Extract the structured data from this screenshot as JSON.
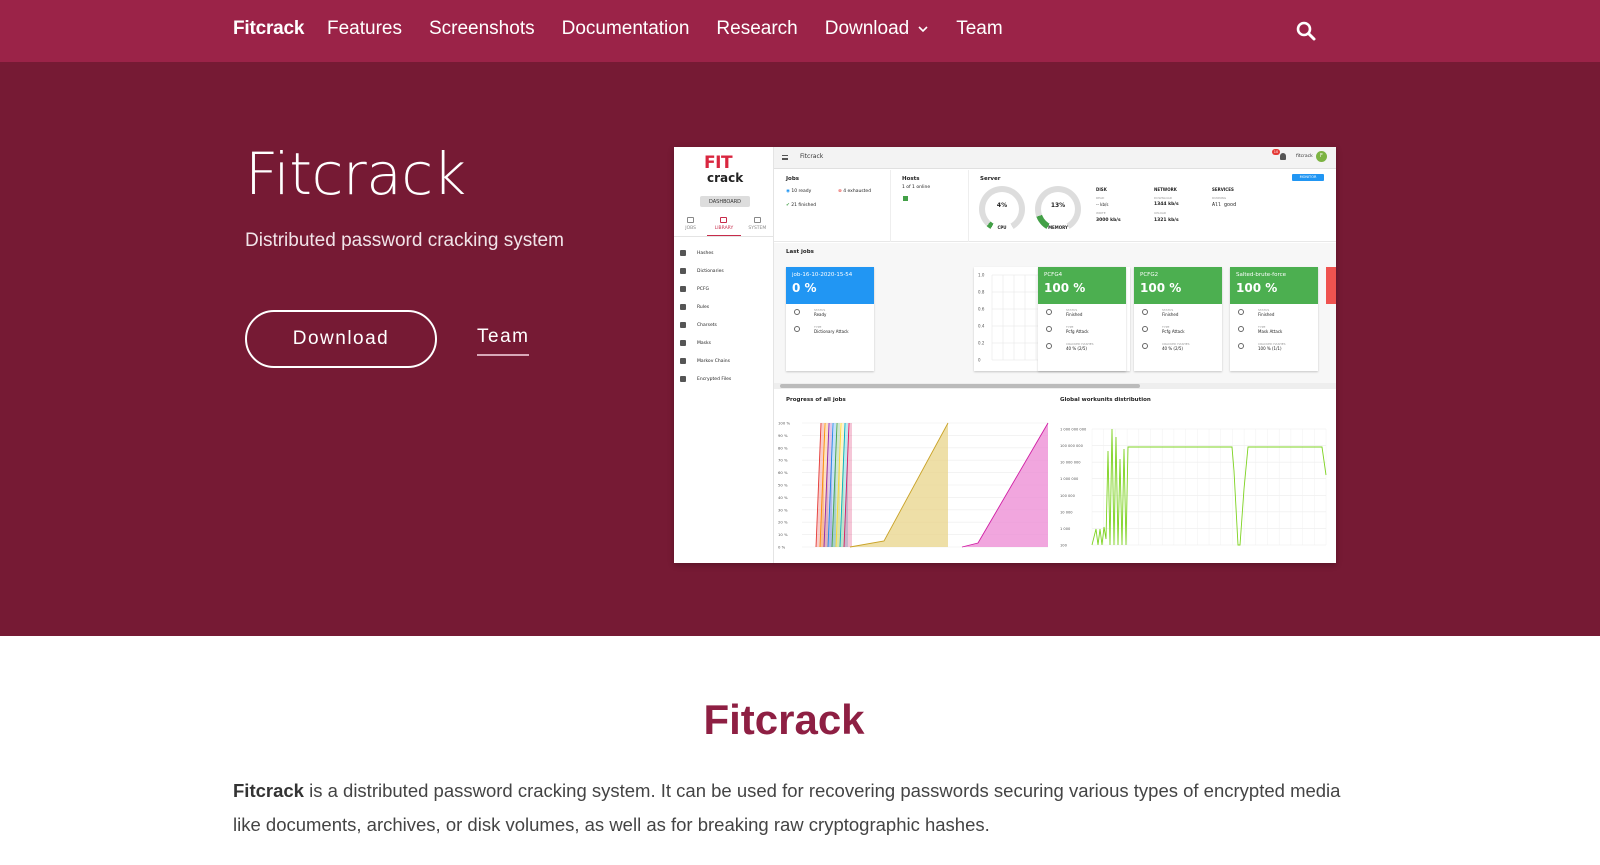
{
  "nav": {
    "brand": "Fitcrack",
    "items": [
      "Features",
      "Screenshots",
      "Documentation",
      "Research",
      "Download",
      "Team"
    ]
  },
  "hero": {
    "title": "Fitcrack",
    "subtitle": "Distributed password cracking system",
    "download_button": "Download",
    "team_link": "Team"
  },
  "screenshot": {
    "logo_top": "FIT",
    "logo_bottom": "crack",
    "dashboard_label": "DASHBOARD",
    "tabs": [
      "JOBS",
      "LIBRARY",
      "SYSTEM"
    ],
    "active_tab": "LIBRARY",
    "menu": [
      "Hashes",
      "Dictionaries",
      "PCFG",
      "Rules",
      "Charsets",
      "Masks",
      "Markov Chains",
      "Encrypted Files"
    ],
    "topbar_title": "Fitcrack",
    "user": "fitcrack",
    "user_initial": "F",
    "notif_count": "10",
    "jobs": {
      "title": "Jobs",
      "ready": "10 ready",
      "exhausted": "4 exhausted",
      "finished": "21 finished"
    },
    "hosts": {
      "title": "Hosts",
      "online": "1 of 1 online"
    },
    "server": {
      "title": "Server",
      "cpu_value": "4%",
      "cpu_label": "CPU",
      "mem_value": "13%",
      "mem_label": "MEMORY",
      "disk_label": "DISK",
      "disk_read": "READ",
      "disk_read_val": "-- kb/s",
      "disk_write": "WRITE",
      "disk_write_val": "3000 kb/s",
      "network_label": "NETWORK",
      "net_download": "DOWNLOAD",
      "net_download_val": "1344 kb/s",
      "net_upload": "UPLOAD",
      "net_upload_val": "1321 kb/s",
      "services_label": "SERVICES",
      "services_running": "RUNNING",
      "services_status": "All good",
      "monitor": "MONITOR"
    },
    "last_jobs_title": "Last jobs",
    "job_cards": [
      {
        "name": "job-16-10-2020-15-54",
        "progress": "0 %",
        "status": "Ready",
        "type": "Dictionary Attack",
        "cracked": "",
        "color": "#2196f3"
      },
      {
        "name": "PCFG4",
        "progress": "100 %",
        "status": "Finished",
        "type": "Pcfg Attack",
        "cracked": "40 % (2/5)",
        "color": "#4caf50"
      },
      {
        "name": "PCFG2",
        "progress": "100 %",
        "status": "Finished",
        "type": "Pcfg Attack",
        "cracked": "40 % (2/5)",
        "color": "#4caf50"
      },
      {
        "name": "Salted-brute-force",
        "progress": "100 %",
        "status": "Finished",
        "type": "Mask Attack",
        "cracked": "100 % (1/1)",
        "color": "#4caf50"
      }
    ],
    "row_labels": {
      "status": "STATUS",
      "type": "TYPE",
      "cracked": "CRACKED HASHES"
    },
    "progress_chart_title": "Progress of all jobs",
    "workunits_chart_title": "Global workunits distribution",
    "progress_y_ticks": [
      "100 %",
      "90 %",
      "80 %",
      "70 %",
      "60 %",
      "50 %",
      "40 %",
      "30 %",
      "20 %",
      "10 %",
      "0 %"
    ],
    "workunit_y_ticks": [
      "1 000 000 000",
      "100 000 000",
      "10 000 000",
      "1 000 000",
      "100 000",
      "10 000",
      "1 000",
      "100"
    ],
    "mini_y_ticks": [
      "1.0",
      "0.8",
      "0.6",
      "0.4",
      "0.2",
      "0"
    ]
  },
  "content": {
    "title": "Fitcrack",
    "para_bold": "Fitcrack",
    "para_rest": " is a distributed password cracking system. It can be used for recovering passwords securing various types of encrypted media like documents, archives, or disk volumes, as well as for breaking raw cryptographic hashes."
  },
  "colors": {
    "navbar": "#9b2348",
    "hero": "#761a34",
    "title_accent": "#8e1f43"
  }
}
